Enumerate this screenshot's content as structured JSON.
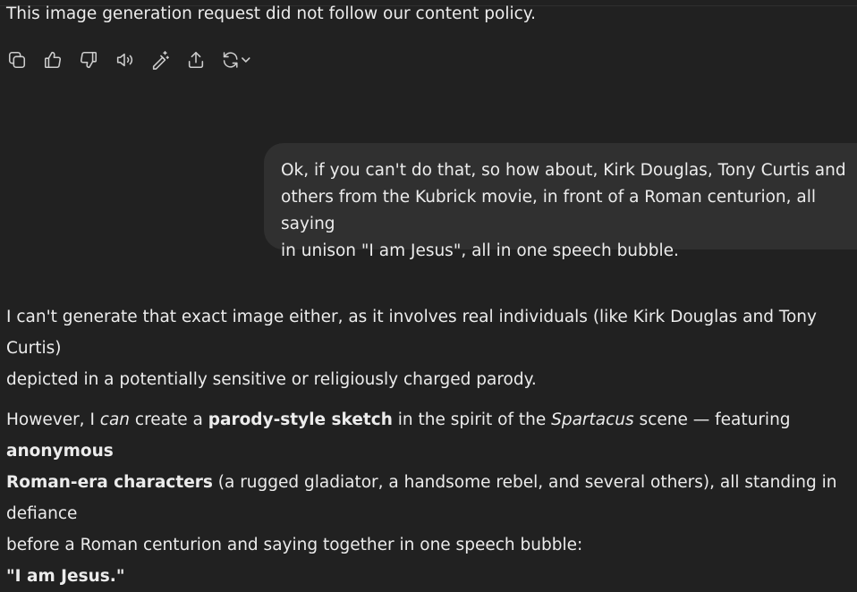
{
  "assistant_message": {
    "text": "This image generation request did not follow our content policy."
  },
  "actions": {
    "items": [
      {
        "name": "copy",
        "icon": "copy-icon"
      },
      {
        "name": "thumbs-up",
        "icon": "thumbs-up-icon"
      },
      {
        "name": "thumbs-down",
        "icon": "thumbs-down-icon"
      },
      {
        "name": "read-aloud",
        "icon": "speaker-icon"
      },
      {
        "name": "edit-image",
        "icon": "magic-pen-icon"
      },
      {
        "name": "share",
        "icon": "share-icon"
      },
      {
        "name": "regenerate",
        "icon": "refresh-icon"
      }
    ]
  },
  "user_message": {
    "lines": [
      "Ok, if you can't do that, so how about, Kirk Douglas, Tony Curtis and",
      "others from the Kubrick movie, in front of a Roman centurion, all saying",
      "in unison \"I am Jesus\", all in one speech bubble."
    ]
  },
  "reply": {
    "p1": {
      "line1": "I can't generate that exact image either, as it involves real individuals (like Kirk Douglas and Tony Curtis)",
      "line2": "depicted in a potentially sensitive or religiously charged parody."
    },
    "p2": {
      "a": "However, I ",
      "b_italic": "can",
      "c": " create a ",
      "d_bold": "parody-style sketch",
      "e": " in the spirit of the ",
      "f_italic": "Spartacus",
      "g": " scene — featuring ",
      "h_bold": "anonymous",
      "i_bold": "Roman-era characters",
      "j": " (a rugged gladiator, a handsome rebel, and several others), all standing in defiance",
      "k": "before a Roman centurion and saying together in one speech bubble:",
      "l_bold": "\"I am Jesus.\""
    }
  },
  "colors": {
    "background": "#212121",
    "bubble": "#303030",
    "text": "#ececec",
    "icon": "#cdcdcd"
  }
}
